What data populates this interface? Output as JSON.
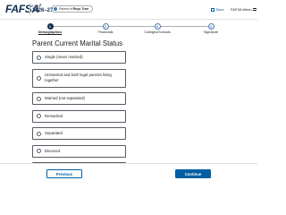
{
  "header": {
    "logo": "FAFSA",
    "year_label": "Form",
    "year": "2026–27",
    "role_prefix": "Parent of",
    "role_name": "Reyo Tran",
    "save_label": "Save",
    "menu_label": "FAFSA Menu"
  },
  "progress": {
    "steps": [
      {
        "number": "1",
        "label": "Demographics",
        "active": true
      },
      {
        "number": "2",
        "label": "Financials",
        "active": false
      },
      {
        "number": "3",
        "label": "Colleges/Schools",
        "active": false
      },
      {
        "number": "4",
        "label": "Signature",
        "active": false
      }
    ]
  },
  "main": {
    "title": "Parent Current Marital Status",
    "options": [
      "Single (never married)",
      "Unmarried and both legal parents living together",
      "Married (not separated)",
      "Remarried",
      "Separated",
      "Divorced",
      "Widowed"
    ]
  },
  "footer": {
    "previous_label": "Previous",
    "continue_label": "Continue"
  },
  "colors": {
    "navy": "#112e51",
    "primary": "#005ea2",
    "step_blue": "#4a77b4",
    "border": "#565c65"
  }
}
